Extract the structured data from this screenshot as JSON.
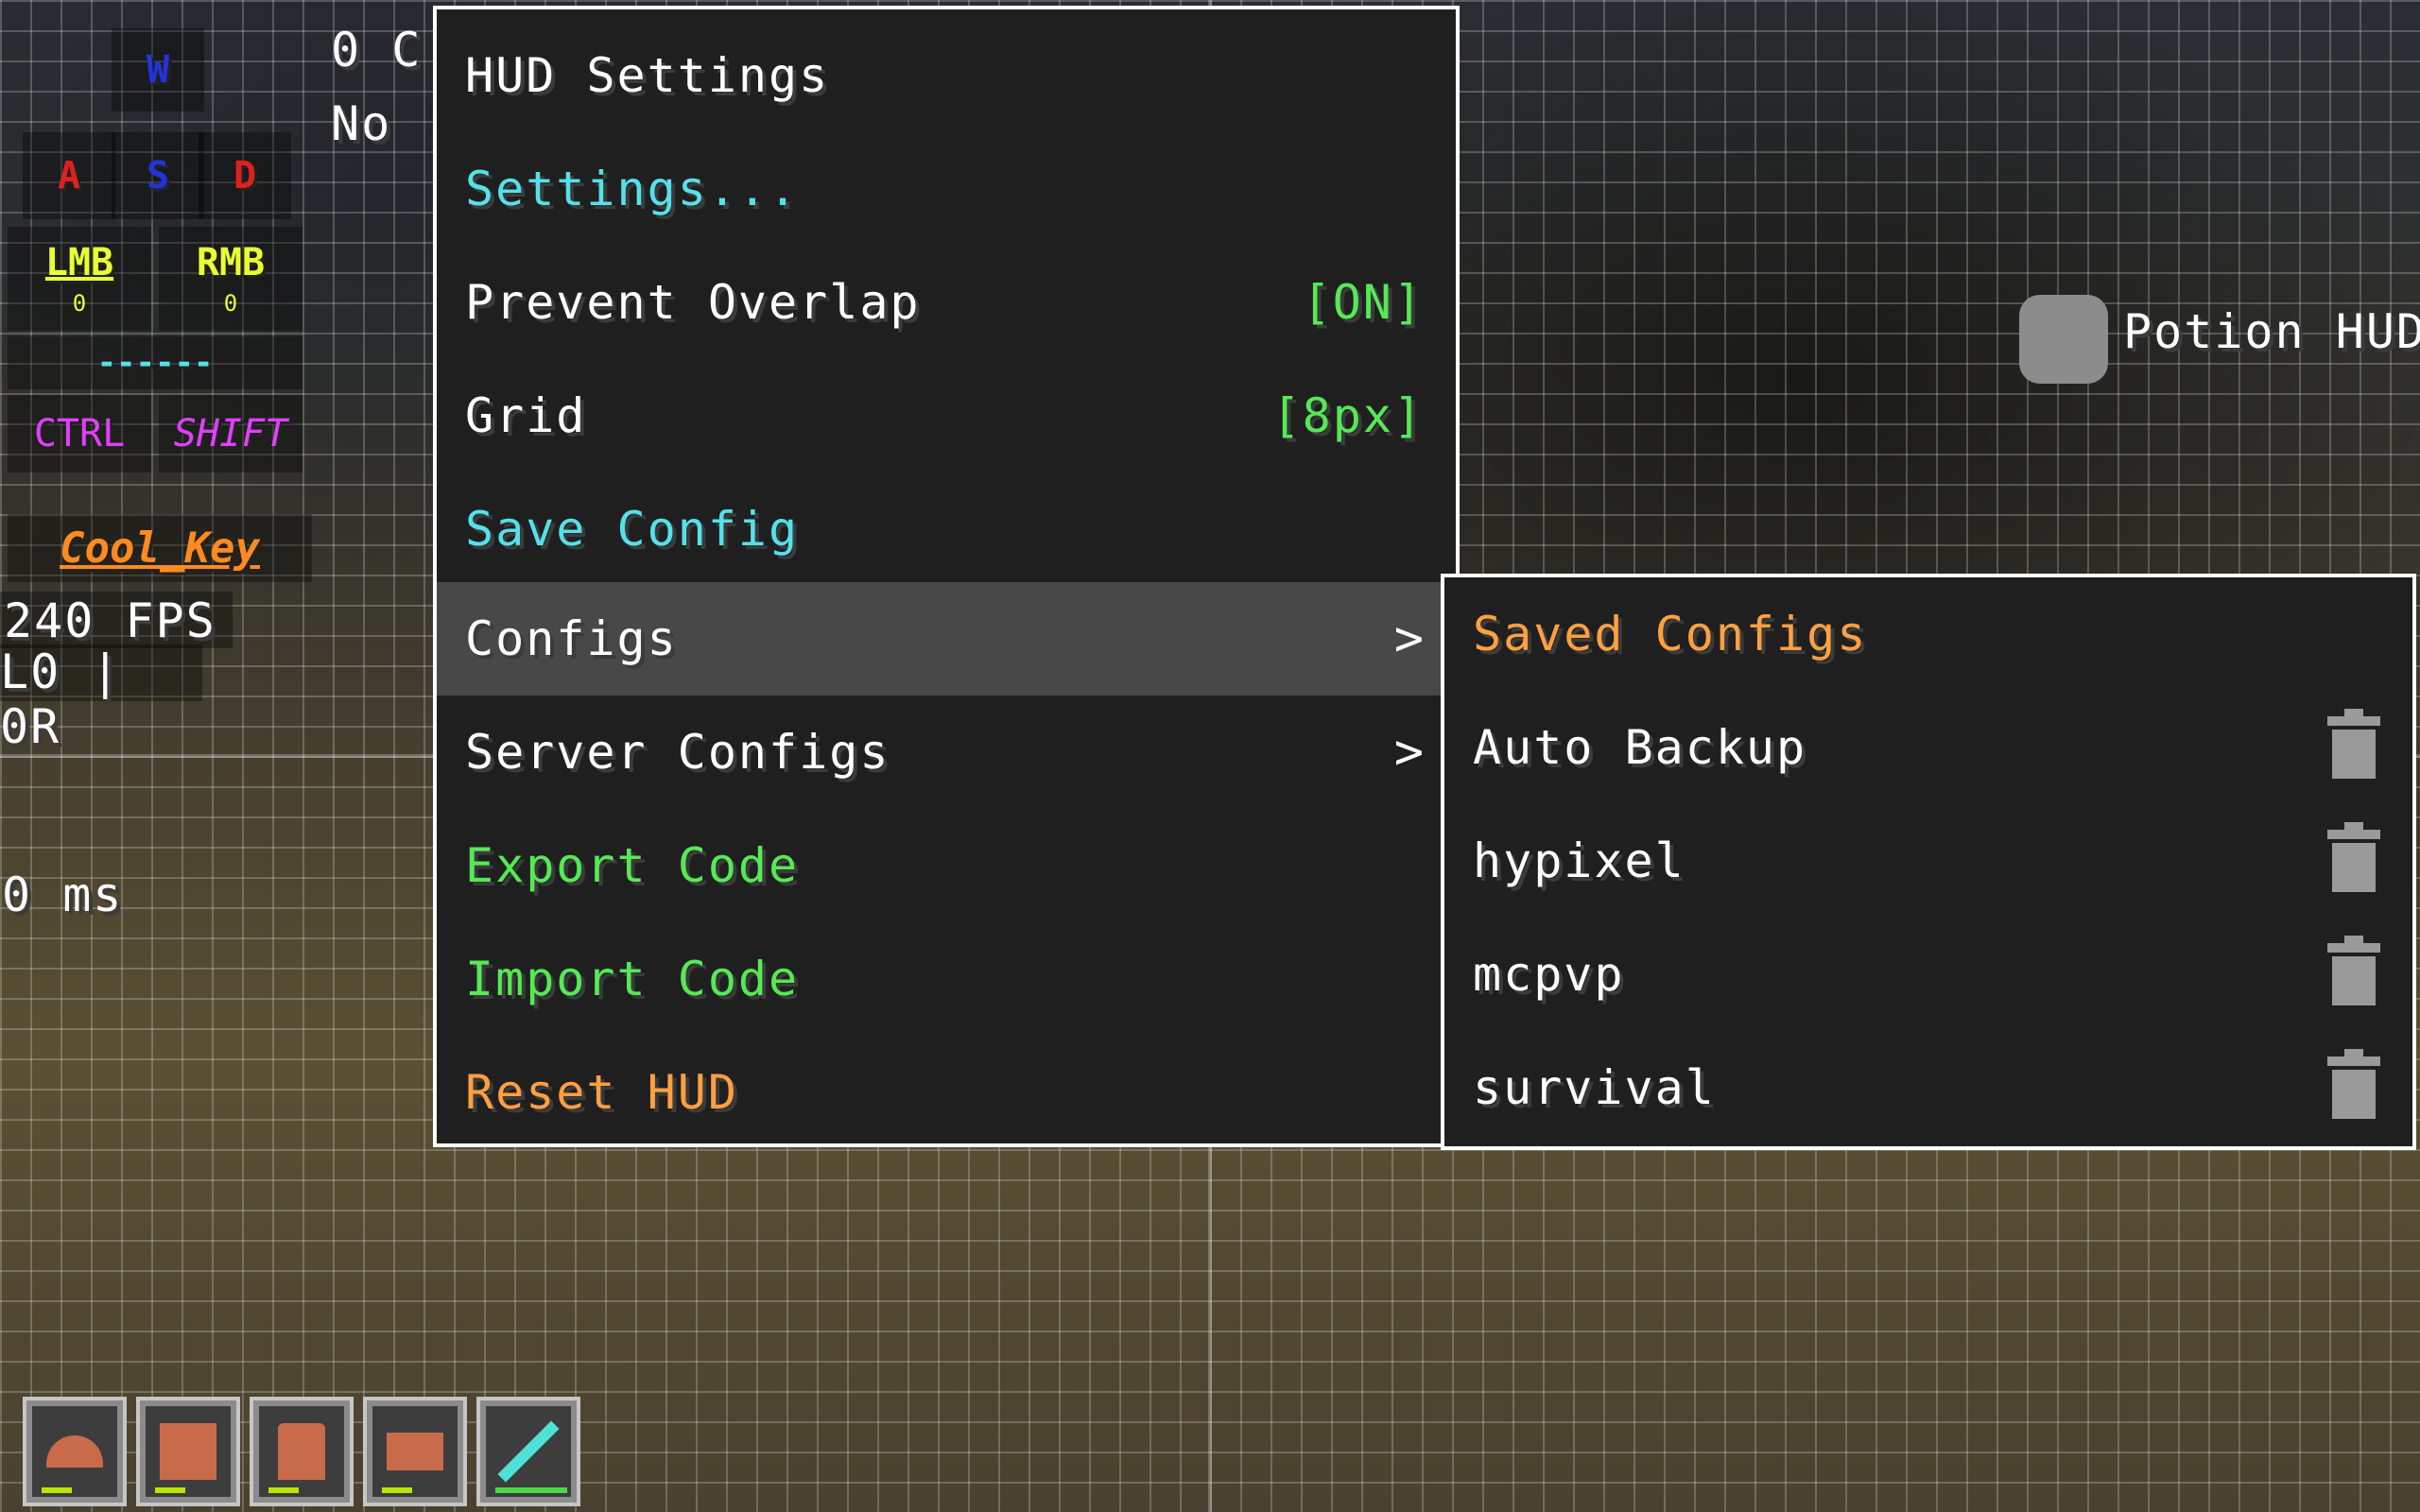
{
  "top_left_text": {
    "line1": "0 C",
    "line2": "No "
  },
  "keystrokes": {
    "w": "W",
    "a": "A",
    "s": "S",
    "d": "D",
    "lmb": "LMB",
    "lmb_count": "0",
    "rmb": "RMB",
    "rmb_count": "0",
    "space": "------",
    "ctrl": "CTRL",
    "shift": "SHIFT"
  },
  "player_name": "Cool_Key",
  "fps": "240 FPS",
  "cps": "L0 | 0R",
  "ping": "0 ms",
  "potion_hud": "Potion HUD",
  "menu": {
    "title": "HUD Settings",
    "items": [
      {
        "label": "Settings...",
        "value": "",
        "color": "#55e1ea"
      },
      {
        "label": "Prevent Overlap",
        "value": "[ON]",
        "color": "#ffffff"
      },
      {
        "label": "Grid",
        "value": "[8px]",
        "color": "#ffffff"
      },
      {
        "label": "Save Config",
        "value": "",
        "color": "#55e1ea"
      },
      {
        "label": "Configs",
        "value": ">",
        "color": "#ffffff"
      },
      {
        "label": "Server Configs",
        "value": ">",
        "color": "#ffffff"
      },
      {
        "label": "Export Code",
        "value": "",
        "color": "#55ea55"
      },
      {
        "label": "Import Code",
        "value": "",
        "color": "#55ea55"
      },
      {
        "label": "Reset HUD",
        "value": "",
        "color": "#ffa040"
      }
    ]
  },
  "submenu": {
    "title": "Saved Configs",
    "items": [
      "Auto Backup",
      "hypixel",
      "mcpvp",
      "survival"
    ]
  },
  "colors": {
    "cyan": "#55e1ea",
    "green": "#55ea55",
    "orange": "#ffa040",
    "value_green": "#55ea55",
    "key_blue": "#2233dd",
    "key_red": "#e02020",
    "key_yellow": "#e8ff33",
    "key_magenta": "#e040fb",
    "name_orange": "#ff8a1f"
  },
  "hotbar": [
    "helmet-icon",
    "chestplate-icon",
    "leggings-icon",
    "boots-icon",
    "diamond-sword-icon"
  ]
}
